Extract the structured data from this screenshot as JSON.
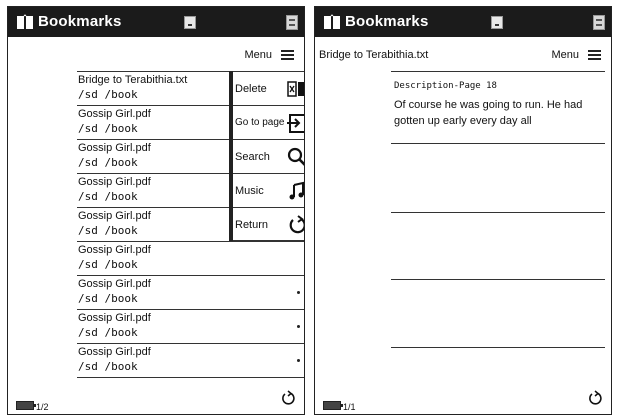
{
  "left": {
    "title": "Bookmarks",
    "menu_label": "Menu",
    "items": [
      {
        "name": "Bridge to Terabithia.txt",
        "path": "/sd /book"
      },
      {
        "name": "Gossip Girl.pdf",
        "path": "/sd /book"
      },
      {
        "name": "Gossip Girl.pdf",
        "path": "/sd /book"
      },
      {
        "name": "Gossip Girl.pdf",
        "path": "/sd /book"
      },
      {
        "name": "Gossip Girl.pdf",
        "path": "/sd /book"
      },
      {
        "name": "Gossip Girl.pdf",
        "path": "/sd /book"
      },
      {
        "name": "Gossip Girl.pdf",
        "path": "/sd /book"
      },
      {
        "name": "Gossip Girl.pdf",
        "path": "/sd /book"
      },
      {
        "name": "Gossip Girl.pdf",
        "path": "/sd /book"
      }
    ],
    "context_menu": [
      {
        "label": "Delete",
        "icon": "delete-book-icon"
      },
      {
        "label": "Go to page",
        "icon": "goto-page-icon"
      },
      {
        "label": "Search",
        "icon": "search-icon"
      },
      {
        "label": "Music",
        "icon": "music-note-icon"
      },
      {
        "label": "Return",
        "icon": "return-icon"
      }
    ],
    "page_indicator": "1/2"
  },
  "right": {
    "title": "Bookmarks",
    "file_title": "Bridge to Terabithia.txt",
    "menu_label": "Menu",
    "description_heading": "Description-Page 18",
    "description_text": "Of course he was going to run. He had gotten up early every day all",
    "page_indicator": "1/1"
  },
  "colors": {
    "titlebar": "#1b1b1b",
    "ink": "#111111",
    "paper": "#ffffff"
  }
}
